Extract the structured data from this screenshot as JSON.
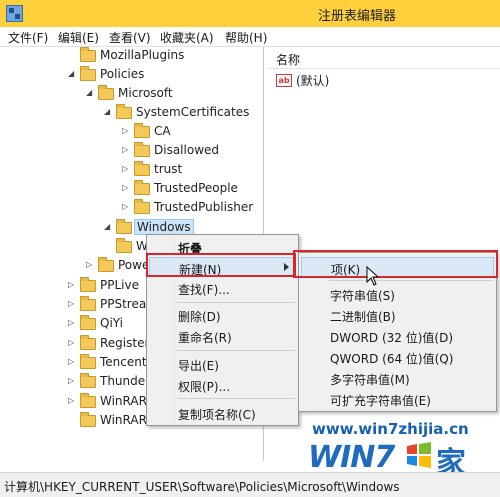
{
  "window": {
    "title": "注册表编辑器"
  },
  "menubar": [
    "文件(F)",
    "编辑(E)",
    "查看(V)",
    "收藏夹(A)",
    "帮助(H)"
  ],
  "tree": [
    {
      "label": "MozillaPlugins"
    },
    {
      "label": "Policies"
    },
    {
      "label": "Microsoft"
    },
    {
      "label": "SystemCertificates"
    },
    {
      "label": "CA"
    },
    {
      "label": "Disallowed"
    },
    {
      "label": "trust"
    },
    {
      "label": "TrustedPeople"
    },
    {
      "label": "TrustedPublisher"
    },
    {
      "label": "Windows"
    },
    {
      "label": "W"
    },
    {
      "label": "Powe"
    },
    {
      "label": "PPLive"
    },
    {
      "label": "PPStrea"
    },
    {
      "label": "QiYi"
    },
    {
      "label": "Register"
    },
    {
      "label": "Tencent"
    },
    {
      "label": "Thunder"
    },
    {
      "label": "WinRAR"
    },
    {
      "label": "WinRAR SFX"
    }
  ],
  "right_pane": {
    "column_header": "名称",
    "default_value": "(默认)",
    "value_icon": "string-value-icon"
  },
  "context_menu": {
    "items": [
      {
        "label": "折叠"
      },
      {
        "label": "新建(N)"
      },
      {
        "label": "查找(F)..."
      },
      {
        "label": "删除(D)"
      },
      {
        "label": "重命名(R)"
      },
      {
        "label": "导出(E)"
      },
      {
        "label": "权限(P)..."
      },
      {
        "label": "复制项名称(C)"
      }
    ]
  },
  "submenu": {
    "items": [
      {
        "label": "项(K)"
      },
      {
        "label": "字符串值(S)"
      },
      {
        "label": "二进制值(B)"
      },
      {
        "label": "DWORD (32 位)值(D)"
      },
      {
        "label": "QWORD (64 位)值(Q)"
      },
      {
        "label": "多字符串值(M)"
      },
      {
        "label": "可扩充字符串值(E)"
      }
    ]
  },
  "statusbar": {
    "path": "计算机\\HKEY_CURRENT_USER\\Software\\Policies\\Microsoft\\Windows"
  },
  "watermark": {
    "url": "www.win7zhijia.cn",
    "logo": "WIN7",
    "han": "家"
  },
  "colors": {
    "titlebar": "#ffd03c",
    "highlight_red": "#d9262b",
    "selection": "#cce4f7",
    "watermark_blue": "#1e6cc0"
  }
}
